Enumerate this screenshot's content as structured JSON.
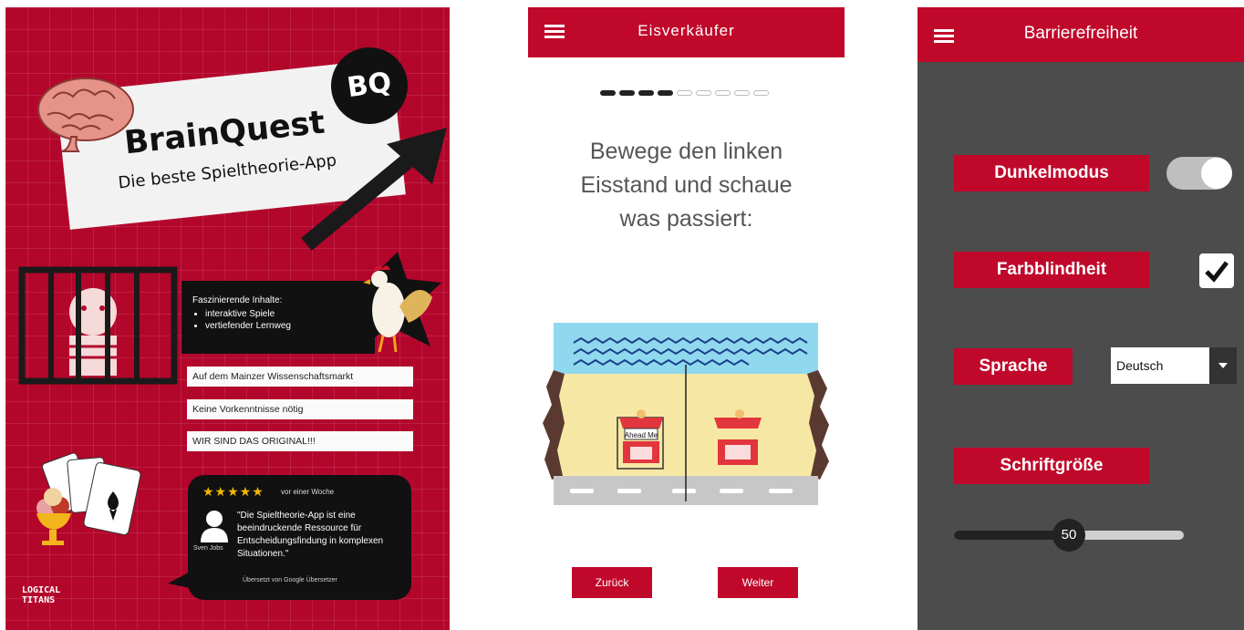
{
  "poster": {
    "title": "BrainQuest",
    "subtitle": "Die beste Spieltheorie-App",
    "logo_text": "BQ",
    "features_header": "Faszinierende Inhalte:",
    "features": [
      "interaktive Spiele",
      "vertiefender Lernweg"
    ],
    "ribbons": [
      "Auf dem Mainzer Wissenschaftsmarkt",
      "Keine Vorkenntnisse nötig",
      "WIR SIND DAS ORIGINAL!!!"
    ],
    "review": {
      "stars": "★★★★★",
      "time": "vor einer Woche",
      "reviewer": "Sven Jobs",
      "quote": "\"Die Spieltheorie-App ist eine beeindruckende Ressource für Entscheidungsfindung in komplexen Situationen.\"",
      "translated": "Übersetzt von Google Übersetzer"
    },
    "company_logo": [
      "LOGICAL",
      "TITANS"
    ],
    "colors": {
      "background": "#b3062b",
      "card": "#f2f2f2",
      "dark": "#111111",
      "star": "#f5b800"
    }
  },
  "game": {
    "title": "Eisverkäufer",
    "progress": {
      "total": 9,
      "done": 4
    },
    "instruction": "Bewege den linken Eisstand und schaue was passiert:",
    "stand_sign": "Ahead Me",
    "back_label": "Zurück",
    "next_label": "Weiter",
    "colors": {
      "accent": "#c0082b",
      "sea": "#8fd8ee",
      "sand": "#f7e7a4",
      "road": "#c7c7c7"
    }
  },
  "settings": {
    "title": "Barrierefreiheit",
    "dark_mode_label": "Dunkelmodus",
    "dark_mode_on": true,
    "colorblind_label": "Farbblindheit",
    "colorblind_checked": true,
    "language_label": "Sprache",
    "language_value": "Deutsch",
    "font_size_label": "Schriftgröße",
    "font_size_value": "50",
    "font_size_fraction": 0.5,
    "colors": {
      "background": "#4c4c4c",
      "accent": "#c0082b"
    }
  }
}
